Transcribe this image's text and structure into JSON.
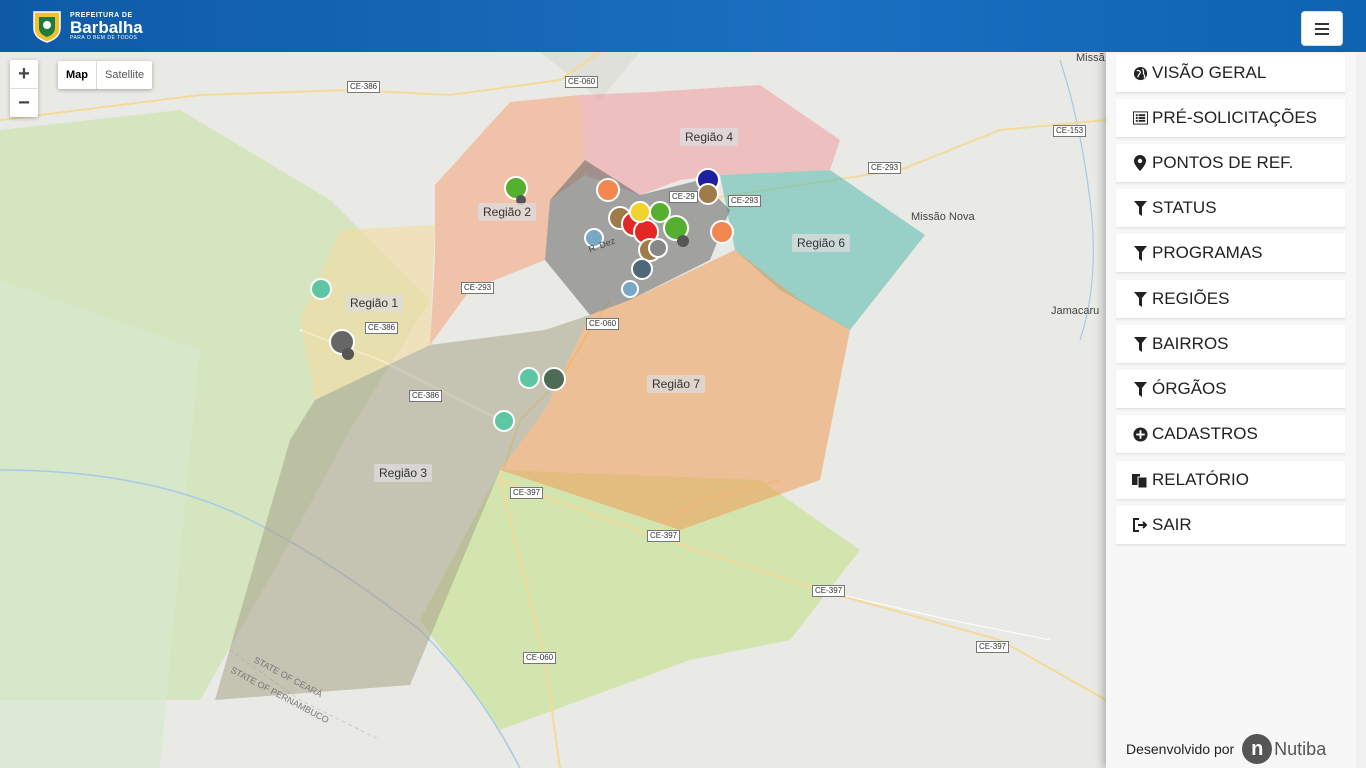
{
  "header": {
    "logo_small": "PREFEITURA DE",
    "logo_big": "Barbalha",
    "logo_tag": "PARA O BEM DE TODOS",
    "menu_icon": "hamburger-icon"
  },
  "map": {
    "zoom_in": "+",
    "zoom_out": "−",
    "type_map": "Map",
    "type_satellite": "Satellite",
    "regions": [
      "Região 1",
      "Região 2",
      "Região 3",
      "Região 4",
      "Região 6",
      "Região 7"
    ],
    "roads": [
      "CE-060",
      "CE-386",
      "CE-293",
      "CE-153",
      "CE-397",
      "CE-29"
    ],
    "towns": [
      "Missão Nova",
      "Jamacaru",
      "Missã"
    ],
    "state_line_1": "STATE OF CEARÁ",
    "state_line_2": "STATE OF PERNAMBUCO",
    "street": "R. Dez"
  },
  "sidebar": {
    "items": [
      {
        "label": "VISÃO GERAL",
        "icon": "globe-icon"
      },
      {
        "label": "PRÉ-SOLICITAÇÕES",
        "icon": "list-icon"
      },
      {
        "label": "PONTOS DE REF.",
        "icon": "map-marker-icon"
      },
      {
        "label": "STATUS",
        "icon": "filter-icon"
      },
      {
        "label": "PROGRAMAS",
        "icon": "filter-icon"
      },
      {
        "label": "REGIÕES",
        "icon": "filter-icon"
      },
      {
        "label": "BAIRROS",
        "icon": "filter-icon"
      },
      {
        "label": "ÓRGÃOS",
        "icon": "filter-icon"
      },
      {
        "label": "CADASTROS",
        "icon": "plus-circle-icon"
      },
      {
        "label": "RELATÓRIO",
        "icon": "copy-icon"
      },
      {
        "label": "SAIR",
        "icon": "logout-icon"
      }
    ],
    "footer_text": "Desenvolvido por",
    "brand_letter": "n",
    "brand": "Nutiba"
  }
}
